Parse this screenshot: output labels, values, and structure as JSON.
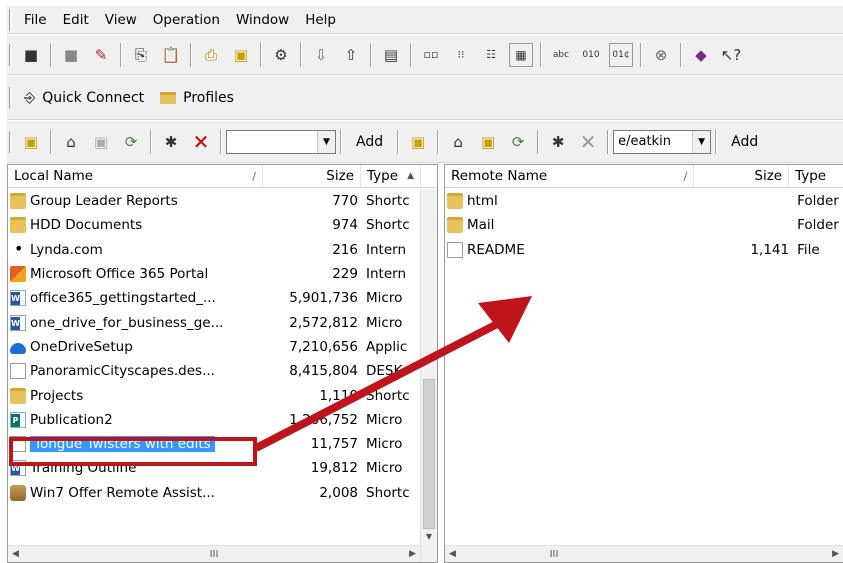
{
  "menu": [
    "File",
    "Edit",
    "View",
    "Operation",
    "Window",
    "Help"
  ],
  "toolbar2": {
    "quick_connect_label": "Quick Connect",
    "profiles_label": "Profiles"
  },
  "local_bar": {
    "combo_value": "",
    "add_label": "Add"
  },
  "remote_bar": {
    "combo_value": "e/eatkin",
    "add_label": "Add"
  },
  "local": {
    "columns": [
      "Local Name",
      "Size",
      "Type"
    ],
    "sort_indicator": "/",
    "rows": [
      {
        "name": "Group Leader Reports",
        "size": "770",
        "type": "Shortc",
        "icon": "folder"
      },
      {
        "name": "HDD Documents",
        "size": "974",
        "type": "Shortc",
        "icon": "folder"
      },
      {
        "name": "Lynda.com",
        "size": "216",
        "type": "Intern",
        "icon": "link"
      },
      {
        "name": "Microsoft Office 365 Portal",
        "size": "229",
        "type": "Intern",
        "icon": "office"
      },
      {
        "name": "office365_gettingstarted_...",
        "size": "5,901,736",
        "type": "Micro",
        "icon": "word"
      },
      {
        "name": "one_drive_for_business_ge...",
        "size": "2,572,812",
        "type": "Micro",
        "icon": "word"
      },
      {
        "name": "OneDriveSetup",
        "size": "7,210,656",
        "type": "Applic",
        "icon": "cloud"
      },
      {
        "name": "PanoramicCityscapes.des...",
        "size": "8,415,804",
        "type": "DESK",
        "icon": "doc"
      },
      {
        "name": "Projects",
        "size": "1,110",
        "type": "Shortc",
        "icon": "folder"
      },
      {
        "name": "Publication2",
        "size": "1,206,752",
        "type": "Micro",
        "icon": "pub"
      },
      {
        "name": "Tongue Twisters with edits",
        "size": "11,757",
        "type": "Micro",
        "icon": "doc",
        "selected": true
      },
      {
        "name": "Training Outline",
        "size": "19,812",
        "type": "Micro",
        "icon": "word"
      },
      {
        "name": "Win7 Offer Remote Assist...",
        "size": "2,008",
        "type": "Shortc",
        "icon": "remote"
      }
    ]
  },
  "remote": {
    "columns": [
      "Remote Name",
      "Size",
      "Type"
    ],
    "sort_indicator": "/",
    "rows": [
      {
        "name": "html",
        "size": "",
        "type": "Folder",
        "icon": "folder"
      },
      {
        "name": "Mail",
        "size": "",
        "type": "Folder",
        "icon": "folder"
      },
      {
        "name": "README",
        "size": "1,141",
        "type": "File",
        "icon": "doc"
      }
    ]
  },
  "colors": {
    "annotation": "#c0141b",
    "selection": "#3399ff"
  }
}
